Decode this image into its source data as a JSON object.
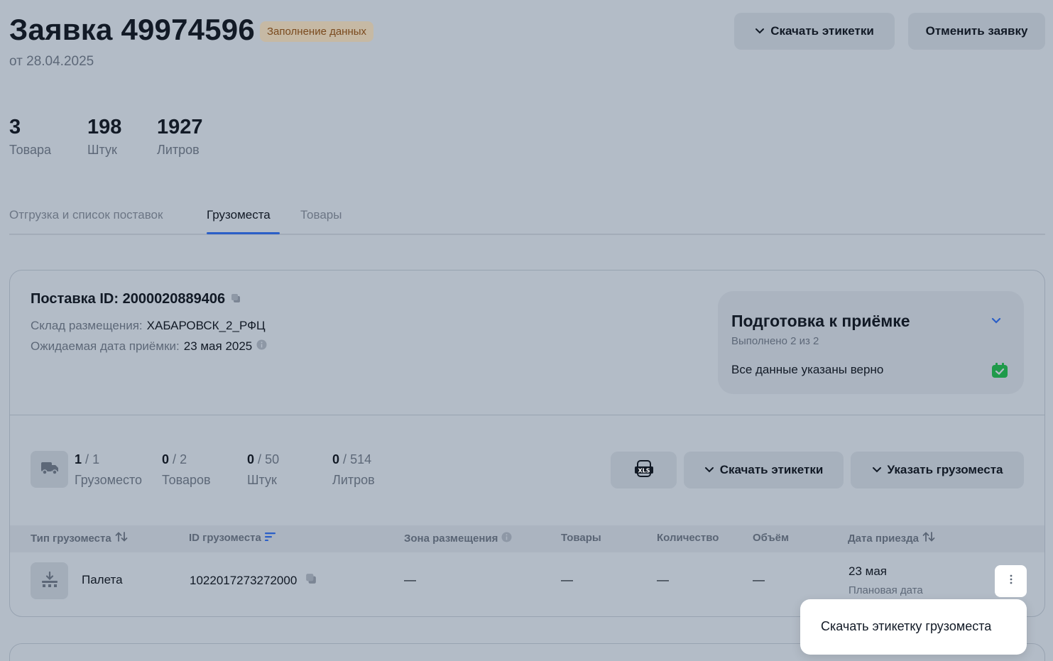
{
  "header": {
    "title": "Заявка 49974596",
    "status": "Заполнение данных",
    "date": "от 28.04.2025",
    "download_labels_btn": "Скачать этикетки",
    "cancel_btn": "Отменить заявку"
  },
  "stats": [
    {
      "value": "3",
      "label": "Товара"
    },
    {
      "value": "198",
      "label": "Штук"
    },
    {
      "value": "1927",
      "label": "Литров"
    }
  ],
  "tabs": [
    {
      "label": "Отгрузка и список поставок",
      "active": false
    },
    {
      "label": "Грузоместа",
      "active": true
    },
    {
      "label": "Товары",
      "active": false
    }
  ],
  "supply": {
    "id_label": "Поставка ID: 2000020889406",
    "warehouse_label": "Склад размещения:",
    "warehouse_value": "ХАБАРОВСК_2_РФЦ",
    "date_label": "Ожидаемая дата приёмки:",
    "date_value": "23 мая 2025"
  },
  "prep": {
    "title": "Подготовка к приёмке",
    "subtitle": "Выполнено 2 из 2",
    "item": "Все данные указаны верно",
    "accent_color": "#1f9a4a"
  },
  "counters": [
    {
      "done": "1",
      "total": "1",
      "label": "Грузоместо"
    },
    {
      "done": "0",
      "total": "2",
      "label": "Товаров"
    },
    {
      "done": "0",
      "total": "50",
      "label": "Штук"
    },
    {
      "done": "0",
      "total": "514",
      "label": "Литров"
    }
  ],
  "counter_sep": "/",
  "actions": {
    "xls_icon": "xls-icon",
    "download_labels": "Скачать этикетки",
    "specify_cargo": "Указать грузоместа"
  },
  "table": {
    "columns": [
      "Тип грузоместа",
      "ID грузоместа",
      "Зона размещения",
      "Товары",
      "Количество",
      "Объём",
      "Дата приезда"
    ],
    "row": {
      "type": "Палета",
      "id": "1022017273272000",
      "zone": "—",
      "goods": "—",
      "quantity": "—",
      "volume": "—",
      "arrival": "23 мая",
      "arrival_note": "Плановая дата"
    }
  },
  "menu": {
    "item": "Скачать этикетку грузоместа"
  },
  "colors": {
    "accent_blue": "#2b5fc7",
    "badge_bg": "#c6b9a4",
    "badge_text": "#7a4a1e"
  }
}
